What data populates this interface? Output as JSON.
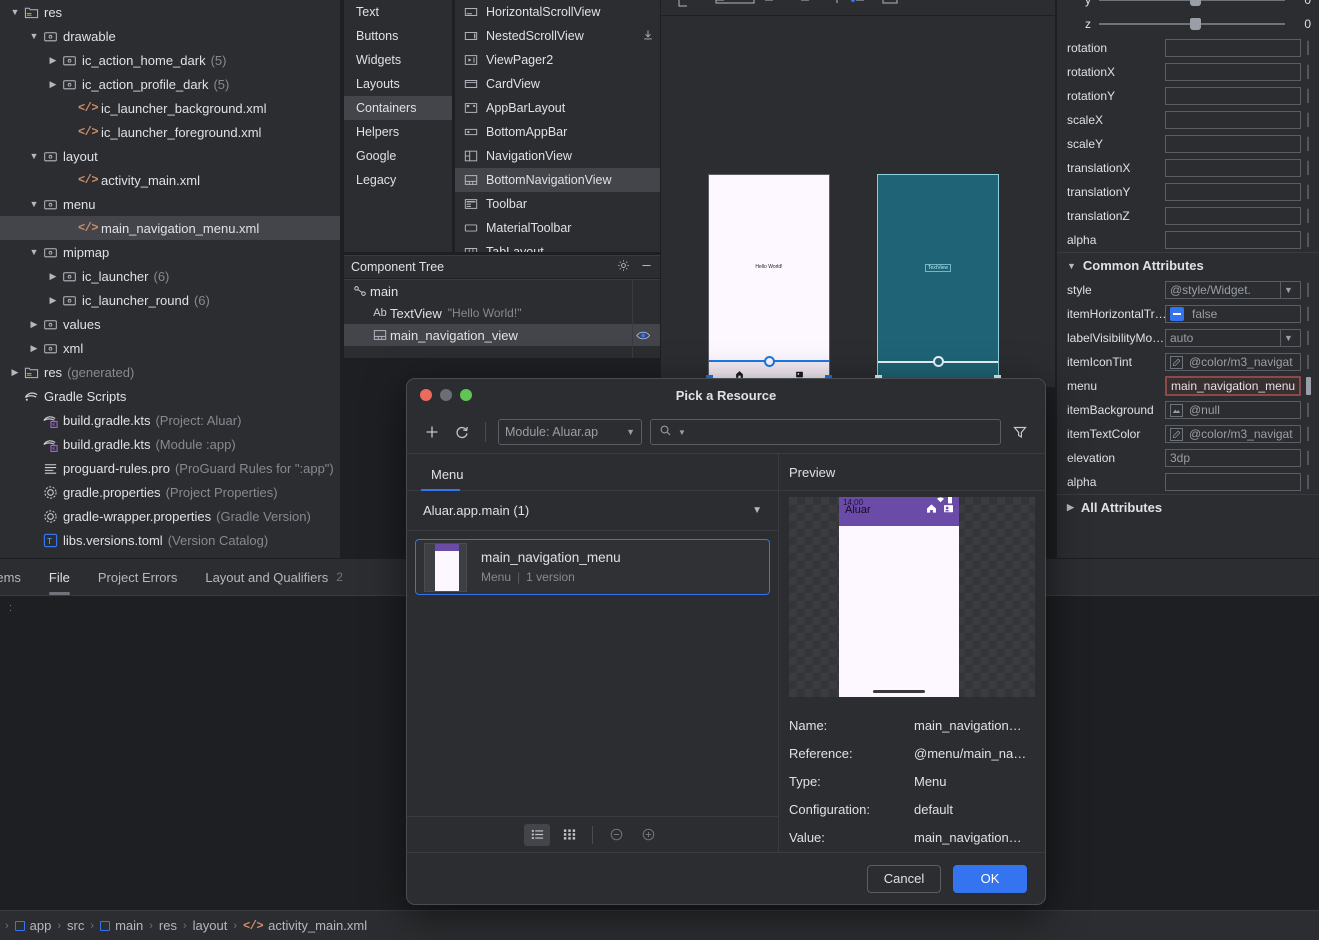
{
  "project_tree": {
    "items": [
      {
        "depth": 0,
        "arrow": "down",
        "icon": "res-folder",
        "label": "res",
        "sub": ""
      },
      {
        "depth": 1,
        "arrow": "down",
        "icon": "folder",
        "label": "drawable",
        "sub": ""
      },
      {
        "depth": 2,
        "arrow": "right",
        "icon": "folder",
        "label": "ic_action_home_dark",
        "sub": "(5)"
      },
      {
        "depth": 2,
        "arrow": "right",
        "icon": "folder",
        "label": "ic_action_profile_dark",
        "sub": "(5)"
      },
      {
        "depth": 3,
        "arrow": "none",
        "icon": "xml",
        "label": "ic_launcher_background.xml",
        "sub": ""
      },
      {
        "depth": 3,
        "arrow": "none",
        "icon": "xml",
        "label": "ic_launcher_foreground.xml",
        "sub": ""
      },
      {
        "depth": 1,
        "arrow": "down",
        "icon": "folder",
        "label": "layout",
        "sub": ""
      },
      {
        "depth": 3,
        "arrow": "none",
        "icon": "xml",
        "label": "activity_main.xml",
        "sub": ""
      },
      {
        "depth": 1,
        "arrow": "down",
        "icon": "folder",
        "label": "menu",
        "sub": ""
      },
      {
        "depth": 3,
        "arrow": "none",
        "icon": "xml",
        "label": "main_navigation_menu.xml",
        "sub": "",
        "selected": true
      },
      {
        "depth": 1,
        "arrow": "down",
        "icon": "folder",
        "label": "mipmap",
        "sub": ""
      },
      {
        "depth": 2,
        "arrow": "right",
        "icon": "folder",
        "label": "ic_launcher",
        "sub": "(6)"
      },
      {
        "depth": 2,
        "arrow": "right",
        "icon": "folder",
        "label": "ic_launcher_round",
        "sub": "(6)"
      },
      {
        "depth": 1,
        "arrow": "right",
        "icon": "folder",
        "label": "values",
        "sub": ""
      },
      {
        "depth": 1,
        "arrow": "right",
        "icon": "folder",
        "label": "xml",
        "sub": ""
      },
      {
        "depth": 0,
        "arrow": "right",
        "icon": "res-folder",
        "label": "res",
        "sub": "(generated)"
      },
      {
        "depth": 0,
        "arrow": "none",
        "icon": "gradle",
        "label": "Gradle Scripts",
        "sub": ""
      },
      {
        "depth": 1,
        "arrow": "none",
        "icon": "gradle-kts",
        "label": "build.gradle.kts",
        "sub": "(Project: Aluar)"
      },
      {
        "depth": 1,
        "arrow": "none",
        "icon": "gradle-kts",
        "label": "build.gradle.kts",
        "sub": "(Module :app)"
      },
      {
        "depth": 1,
        "arrow": "none",
        "icon": "text-file",
        "label": "proguard-rules.pro",
        "sub": "(ProGuard Rules for \":app\")"
      },
      {
        "depth": 1,
        "arrow": "none",
        "icon": "properties",
        "label": "gradle.properties",
        "sub": "(Project Properties)"
      },
      {
        "depth": 1,
        "arrow": "none",
        "icon": "properties",
        "label": "gradle-wrapper.properties",
        "sub": "(Gradle Version)"
      },
      {
        "depth": 1,
        "arrow": "none",
        "icon": "toml",
        "label": "libs.versions.toml",
        "sub": "(Version Catalog)"
      }
    ]
  },
  "palette": {
    "categories": [
      {
        "label": "Text"
      },
      {
        "label": "Buttons"
      },
      {
        "label": "Widgets"
      },
      {
        "label": "Layouts"
      },
      {
        "label": "Containers",
        "selected": true
      },
      {
        "label": "Helpers"
      },
      {
        "label": "Google"
      },
      {
        "label": "Legacy"
      }
    ],
    "items": [
      {
        "label": "HorizontalScrollView",
        "icon": "hscroll-icon"
      },
      {
        "label": "NestedScrollView",
        "icon": "nestedscroll-icon",
        "download": true
      },
      {
        "label": "ViewPager2",
        "icon": "viewpager-icon"
      },
      {
        "label": "CardView",
        "icon": "cardview-icon"
      },
      {
        "label": "AppBarLayout",
        "icon": "appbar-icon"
      },
      {
        "label": "BottomAppBar",
        "icon": "bottomappbar-icon"
      },
      {
        "label": "NavigationView",
        "icon": "navview-icon"
      },
      {
        "label": "BottomNavigationView",
        "icon": "bottomnav-icon",
        "selected": true
      },
      {
        "label": "Toolbar",
        "icon": "toolbar-icon"
      },
      {
        "label": "MaterialToolbar",
        "icon": "materialtoolbar-icon"
      },
      {
        "label": "TabLayout",
        "icon": "tablayout-icon"
      }
    ]
  },
  "component_tree": {
    "title": "Component Tree",
    "rows": [
      {
        "label": "main",
        "hint": "",
        "icon": "constraint-icon",
        "indent": 0
      },
      {
        "label": "TextView",
        "hint": "\"Hello World!\"",
        "icon": "ab-icon",
        "indent": 1
      },
      {
        "label": "main_navigation_view",
        "hint": "",
        "icon": "bottomnav-icon",
        "indent": 1,
        "selected": true,
        "eye": true
      }
    ]
  },
  "design": {
    "render_phone_text": "Hello World!",
    "blueprint_phone_text": "TextView",
    "blueprint_label": "main_navigation_view"
  },
  "attributes": {
    "sliders": [
      {
        "name": "y",
        "value": "0",
        "pos": 49
      },
      {
        "name": "z",
        "value": "0",
        "pos": 49
      }
    ],
    "transform_rows": [
      {
        "name": "rotation",
        "value": ""
      },
      {
        "name": "rotationX",
        "value": ""
      },
      {
        "name": "rotationY",
        "value": ""
      },
      {
        "name": "scaleX",
        "value": ""
      },
      {
        "name": "scaleY",
        "value": ""
      },
      {
        "name": "translationX",
        "value": ""
      },
      {
        "name": "translationY",
        "value": ""
      },
      {
        "name": "translationZ",
        "value": ""
      },
      {
        "name": "alpha",
        "value": ""
      }
    ],
    "common_section_title": "Common Attributes",
    "common_rows": [
      {
        "name": "style",
        "value": "@style/Widget.",
        "kind": "dropdown"
      },
      {
        "name": "itemHorizontalTr…",
        "value": "false",
        "kind": "checkbox"
      },
      {
        "name": "labelVisibilityMo…",
        "value": "auto",
        "kind": "dropdown"
      },
      {
        "name": "itemIconTint",
        "value": "@color/m3_navigat",
        "kind": "color"
      },
      {
        "name": "menu",
        "value": "main_navigation_menu",
        "kind": "highlighted"
      },
      {
        "name": "itemBackground",
        "value": "@null",
        "kind": "drawable"
      },
      {
        "name": "itemTextColor",
        "value": "@color/m3_navigat",
        "kind": "color"
      },
      {
        "name": "elevation",
        "value": "3dp",
        "kind": "text"
      },
      {
        "name": "alpha",
        "value": "",
        "kind": "text"
      }
    ],
    "all_attributes_title": "All Attributes"
  },
  "bottom_tabs": {
    "tabs": [
      {
        "label": "Problems",
        "active": false,
        "count": ""
      },
      {
        "label": "File",
        "active": true,
        "count": ""
      },
      {
        "label": "Project Errors",
        "active": false,
        "count": ""
      },
      {
        "label": "Layout and Qualifiers",
        "active": false,
        "count": "2"
      }
    ]
  },
  "breadcrumb": {
    "crumbs": [
      {
        "label": "app",
        "icon": "module-icon"
      },
      {
        "label": "src",
        "icon": ""
      },
      {
        "label": "main",
        "icon": "module-icon"
      },
      {
        "label": "res",
        "icon": ""
      },
      {
        "label": "layout",
        "icon": ""
      },
      {
        "label": "activity_main.xml",
        "icon": "xml-icon"
      }
    ],
    "separator": "›"
  },
  "dialog": {
    "title": "Pick a Resource",
    "toolbar": {
      "add_label": "+",
      "refresh_label": "⟳",
      "module_label": "Module: Aluar.ap",
      "search_value": "",
      "search_placeholder": "",
      "filter_label": "filter"
    },
    "tabs": [
      {
        "label": "Menu",
        "active": true
      }
    ],
    "group": {
      "label": "Aluar.app.main (1)"
    },
    "resource_items": [
      {
        "name": "main_navigation_menu",
        "type": "Menu",
        "versions": "1 version",
        "selected": true
      }
    ],
    "list_footer": {
      "list_view_label": "list-view",
      "grid_view_label": "grid-view",
      "zoom_out_label": "⊖",
      "zoom_in_label": "⊕"
    },
    "preview": {
      "title": "Preview",
      "phone": {
        "status_time": "14:00",
        "app_title": "Aluar"
      },
      "meta": [
        {
          "key": "Name:",
          "value": "main_navigation…"
        },
        {
          "key": "Reference:",
          "value": "@menu/main_na…"
        },
        {
          "key": "Type:",
          "value": "Menu"
        },
        {
          "key": "Configuration:",
          "value": "default"
        },
        {
          "key": "Value:",
          "value": "main_navigation…"
        }
      ]
    },
    "footer": {
      "cancel_label": "Cancel",
      "ok_label": "OK"
    }
  },
  "colors": {
    "accent_blue": "#3574f0",
    "panel_bg": "#2b2d30",
    "editor_bg": "#1e1f22",
    "selection": "#43454a",
    "highlight_border": "#8a4a4a",
    "xml_icon": "#cf8e6d",
    "purple_appbar": "#6b4ba8",
    "blueprint_teal": "#1e6476"
  }
}
